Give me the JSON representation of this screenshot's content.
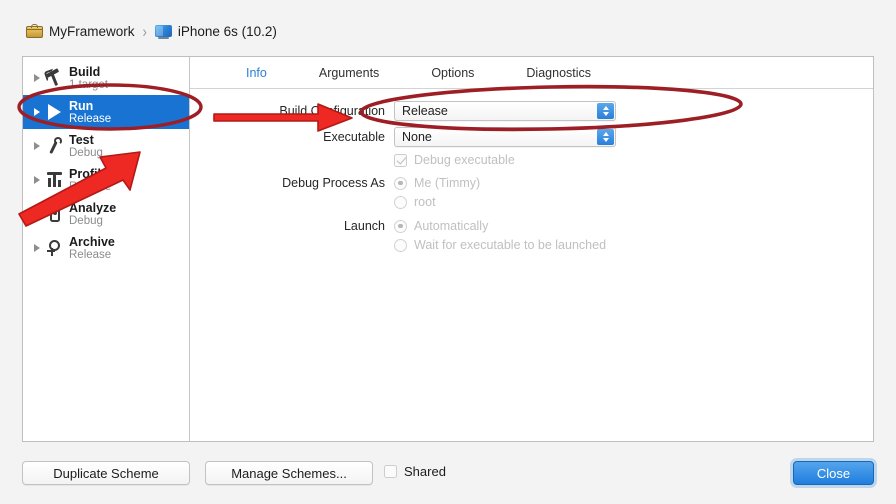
{
  "header": {
    "project_icon": "toolbox-icon",
    "project_name": "MyFramework",
    "separator": "›",
    "device_icon": "simulator-icon",
    "device_name": "iPhone 6s (10.2)"
  },
  "sidebar": {
    "items": [
      {
        "icon": "hammer-icon",
        "title": "Build",
        "subtitle": "1 target",
        "selected": false
      },
      {
        "icon": "play-icon",
        "title": "Run",
        "subtitle": "Release",
        "selected": true
      },
      {
        "icon": "wrench-icon",
        "title": "Test",
        "subtitle": "Debug",
        "selected": false
      },
      {
        "icon": "profile-icon",
        "title": "Profile",
        "subtitle": "Release",
        "selected": false
      },
      {
        "icon": "analyze-icon",
        "title": "Analyze",
        "subtitle": "Debug",
        "selected": false
      },
      {
        "icon": "archive-icon",
        "title": "Archive",
        "subtitle": "Release",
        "selected": false
      }
    ]
  },
  "tabs": [
    {
      "label": "Info",
      "active": true
    },
    {
      "label": "Arguments",
      "active": false
    },
    {
      "label": "Options",
      "active": false
    },
    {
      "label": "Diagnostics",
      "active": false
    }
  ],
  "form": {
    "build_configuration": {
      "label": "Build Configuration",
      "value": "Release",
      "stepper_icon": "chevron-updown-icon"
    },
    "executable": {
      "label": "Executable",
      "value": "None",
      "stepper_icon": "chevron-updown-icon"
    },
    "debug_executable": {
      "label": "Debug executable",
      "checked": true,
      "enabled": false
    },
    "debug_process_as": {
      "label": "Debug Process As",
      "options": [
        {
          "label": "Me (Timmy)",
          "selected": true
        },
        {
          "label": "root",
          "selected": false
        }
      ]
    },
    "launch": {
      "label": "Launch",
      "options": [
        {
          "label": "Automatically",
          "selected": true
        },
        {
          "label": "Wait for executable to be launched",
          "selected": false
        }
      ]
    }
  },
  "footer": {
    "duplicate_scheme": "Duplicate Scheme",
    "manage_schemes": "Manage Schemes...",
    "shared_label": "Shared",
    "shared_checked": false,
    "close": "Close"
  },
  "annotations": {
    "ellipse_color": "#9d1f25",
    "arrow_color": "#ee2822",
    "items": [
      {
        "name": "ellipse-run-row",
        "shape": "ellipse"
      },
      {
        "name": "ellipse-build-configuration",
        "shape": "ellipse"
      },
      {
        "name": "arrow-to-build-configuration",
        "shape": "arrow-right"
      },
      {
        "name": "arrow-to-run-row",
        "shape": "arrow-diagonal"
      }
    ]
  },
  "colors": {
    "selection_blue": "#1873d3",
    "tab_active_blue": "#2b7fd6",
    "stepper_blue": "#2a7fd9",
    "default_button_blue": "#1f7ede"
  }
}
